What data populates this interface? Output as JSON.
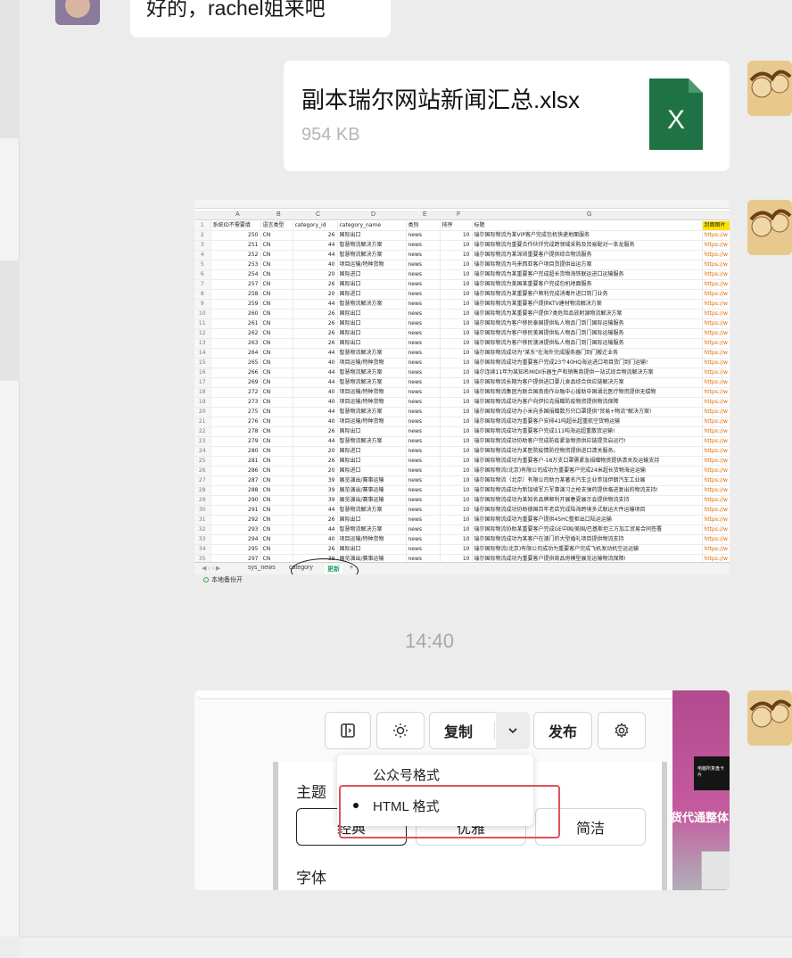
{
  "messages": {
    "reply_text": "好的，rachel姐来吧",
    "file": {
      "name": "副本瑞尔网站新闻汇总.xlsx",
      "size": "954 KB",
      "icon_letter": "X",
      "icon_color": "#1f7244"
    },
    "time_divider": "14:40"
  },
  "spreadsheet": {
    "columns": [
      "A",
      "B",
      "C",
      "D",
      "E",
      "F",
      "G"
    ],
    "headers": [
      "系统ID不需要填",
      "语言类型",
      "category_id",
      "category_name",
      "类别",
      "排序",
      "标题",
      "封面图片"
    ],
    "rows": [
      [
        "250",
        "CN",
        "26",
        "国际出口",
        "news",
        "10",
        "瑞尔国际物流为某VIP客户完成包机快递地面服务",
        "https://w"
      ],
      [
        "251",
        "CN",
        "44",
        "智慧物流解决方案",
        "news",
        "10",
        "瑞尔国际物流为重要合作伙伴完成跨领域采购及贸易配对一条龙服务",
        "https://w"
      ],
      [
        "252",
        "CN",
        "44",
        "智慧物流解决方案",
        "news",
        "10",
        "瑞尔国际物流为某深圳重要客户提供综合物流服务",
        "https://w"
      ],
      [
        "253",
        "CN",
        "40",
        "项目运输/特种货物",
        "news",
        "10",
        "瑞尔国际物流为马来西亚客户项目货提供出运方案",
        "https://w"
      ],
      [
        "254",
        "CN",
        "20",
        "国际进口",
        "news",
        "10",
        "瑞尔国际物流为某重要客户完成超长货物海铁联运进口运输服务",
        "https://w"
      ],
      [
        "257",
        "CN",
        "26",
        "国际出口",
        "news",
        "10",
        "瑞尔国际物流为美国某重要客户完成包机地面服务",
        "https://w"
      ],
      [
        "258",
        "CN",
        "20",
        "国际进口",
        "news",
        "10",
        "瑞尔国际物流为某重要客户顺利完成消毒片进口到门业务",
        "https://w"
      ],
      [
        "259",
        "CN",
        "44",
        "智慧物流解决方案",
        "news",
        "10",
        "瑞尔国际物流为某重要客户提供KTV建材物流解决方案",
        "https://w"
      ],
      [
        "260",
        "CN",
        "26",
        "国际出口",
        "news",
        "10",
        "瑞尔国际物流为某重要客户提供7类危险品放射源物流解决方案",
        "https://w"
      ],
      [
        "261",
        "CN",
        "26",
        "国际出口",
        "news",
        "10",
        "瑞尔国际物流为客户移民泰国提供私人物品门到门国际运输服务",
        "https://w"
      ],
      [
        "262",
        "CN",
        "26",
        "国际出口",
        "news",
        "10",
        "瑞尔国际物流为客户移民美国提供私人物品门到门国际运输服务",
        "https://w"
      ],
      [
        "263",
        "CN",
        "26",
        "国际出口",
        "news",
        "10",
        "瑞尔国际物流为客户移民澳洲提供私人物品门到门国际运输服务",
        "https://w"
      ],
      [
        "264",
        "CN",
        "44",
        "智慧物流解决方案",
        "news",
        "10",
        "瑞尔国际物流成功为\"某东\"在海外完成服务器门到门搬迁业务",
        "https://w"
      ],
      [
        "265",
        "CN",
        "40",
        "项目运输/特种货物",
        "news",
        "10",
        "瑞尔国际物流成功为重要客户完成23个40HQ海运进口项目货门到门运输!",
        "https://w"
      ],
      [
        "266",
        "CN",
        "44",
        "智慧物流解决方案",
        "news",
        "10",
        "瑞尔连续11年为某知名MIDI乐器生产和销售商提供一站式综合物流解决方案",
        "https://w"
      ],
      [
        "269",
        "CN",
        "44",
        "智慧物流解决方案",
        "news",
        "10",
        "瑞尔国际物流长期为客户提供进口婴儿食品综合供应链解决方案",
        "https://w"
      ],
      [
        "272",
        "CN",
        "40",
        "项目运输/特种货物",
        "news",
        "10",
        "瑞尔国际物流集团为联合国南南作业融中心援助中国湖北医疗物资提供无偿物",
        "https://w"
      ],
      [
        "273",
        "CN",
        "40",
        "项目运输/特种货物",
        "news",
        "10",
        "瑞尔国际物流成功为客户向伊拉克捐赠防疫物资提供物流保障",
        "https://w"
      ],
      [
        "275",
        "CN",
        "44",
        "智慧物流解决方案",
        "news",
        "10",
        "瑞尔国际物流成功为小米向多国捐赠数万只口罩提供\"贸易+物流\"解决方案!",
        "https://w"
      ],
      [
        "276",
        "CN",
        "40",
        "项目运输/特种货物",
        "news",
        "10",
        "瑞尔国际物流成功为重要客户安排41吨超长超重航空货物运输",
        "https://w"
      ],
      [
        "278",
        "CN",
        "26",
        "国际出口",
        "news",
        "10",
        "瑞尔国际物流成功为重要客户完成111吨海运超重散货运输!",
        "https://w"
      ],
      [
        "279",
        "CN",
        "44",
        "智慧物流解决方案",
        "news",
        "10",
        "瑞尔国际物流成功协助客户完成防疫紧急物资供应链提货启运行!",
        "https://w"
      ],
      [
        "280",
        "CN",
        "20",
        "国际进口",
        "news",
        "10",
        "瑞尔国际物流成功为某医院疫情防控物资提供进口清关服务。",
        "https://w"
      ],
      [
        "281",
        "CN",
        "26",
        "国际出口",
        "news",
        "10",
        "瑞尔国际物流成功为重要客户-18万支口罩需紧急捐赠物资提供清关及运输支持",
        "https://w"
      ],
      [
        "286",
        "CN",
        "20",
        "国际进口",
        "news",
        "10",
        "瑞尔国际物流(北京)有限公司成功为重要客户完成24米超长货物海运运输",
        "https://w"
      ],
      [
        "287",
        "CN",
        "39",
        "展览演出/赛事运输",
        "news",
        "10",
        "瑞尔国际物流（北京）有限公司助力某著名汽车企业参加伊朗汽车工业展",
        "https://w"
      ],
      [
        "288",
        "CN",
        "39",
        "展览演出/赛事运输",
        "news",
        "10",
        "瑞尔国际物流成功为新加坡军方军事演习之枪支弹药提供临进复出的物流支持!",
        "https://w"
      ],
      [
        "290",
        "CN",
        "39",
        "展览演出/赛事运输",
        "news",
        "10",
        "瑞尔国际物流成功为某知名品牌顺利开展春夏展示会提供物流支持",
        "https://w"
      ],
      [
        "291",
        "CN",
        "44",
        "智慧物流解决方案",
        "news",
        "10",
        "瑞尔国际物流成功协助德国百年老店完成陆海跨境多式联运大件运输项目",
        "https://w"
      ],
      [
        "292",
        "CN",
        "26",
        "国际出口",
        "news",
        "10",
        "瑞尔国际物流成功为重要客户提供45HC整柜出口陆运运输",
        "https://w"
      ],
      [
        "293",
        "CN",
        "44",
        "智慧物流解决方案",
        "news",
        "10",
        "瑞尔国际物流协助某重要客户完成GE中国/美国/巴基斯坦三方加工贸易合同签署",
        "https://w"
      ],
      [
        "294",
        "CN",
        "40",
        "项目运输/特种货物",
        "news",
        "10",
        "瑞尔国际物流成功为某客户在澳门的大型婚礼项目提供物流支持",
        "https://w"
      ],
      [
        "295",
        "CN",
        "26",
        "国际出口",
        "news",
        "10",
        "瑞尔国际物流(北京)有限公司成功为重要客户完成飞机发动机空运运输",
        "https://w"
      ],
      [
        "297",
        "CN",
        "39",
        "展览演出/赛事运输",
        "news",
        "10",
        "瑞尔国际物流成功为重要客户提供商品房模型展览运输物流保障!",
        "https://w"
      ],
      [
        "298",
        "CN",
        "20",
        "国际进口",
        "news",
        "10",
        "瑞尔国际物流成功为重要客户完成42吨超长超重航空货物运输",
        "https://w"
      ],
      [
        "299",
        "CN",
        "40",
        "项目运输/特种货物",
        "news",
        "10",
        "瑞尔国际物流（北京）有限公司成功完成飞机发动机跨境并复进口的重要项目",
        "https://w"
      ]
    ],
    "sheet_tabs": [
      "sys_news",
      "category",
      "更新",
      "+"
    ],
    "active_tab": "更新",
    "status_text": "本地备份开"
  },
  "editor": {
    "toolbar": {
      "copy_label": "复制",
      "publish_label": "发布"
    },
    "dropdown": {
      "items": [
        "公众号格式",
        "HTML 格式"
      ],
      "selected": "HTML 格式"
    },
    "theme_label": "主题",
    "theme_options": [
      "经典",
      "优雅",
      "简洁"
    ],
    "selected_theme": "经典",
    "font_label": "字体",
    "side_preview": {
      "title_text": "货代通整体",
      "mini_text": "电脑所复盘卡片"
    },
    "highlight_color": "#e0525a"
  }
}
